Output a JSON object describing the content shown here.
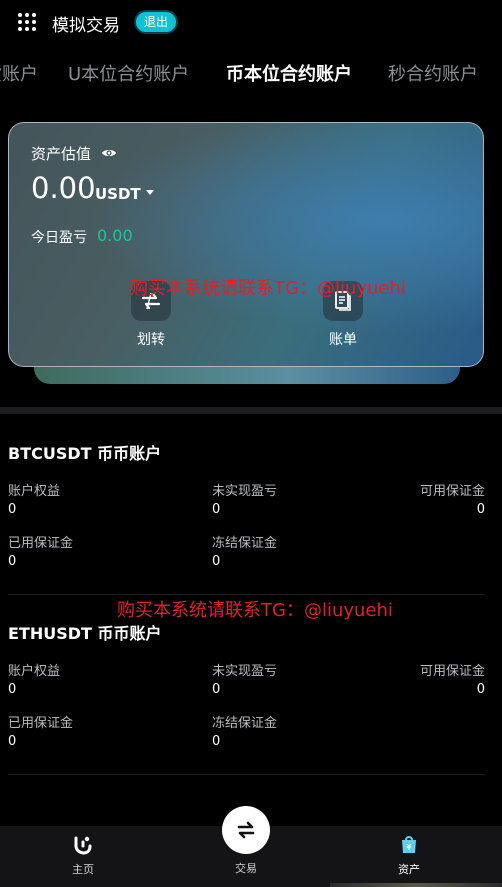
{
  "header": {
    "title": "模拟交易",
    "exit_label": "退出"
  },
  "tabs": [
    {
      "label": "现货账户"
    },
    {
      "label": "U本位合约账户"
    },
    {
      "label": "币本位合约账户",
      "active": true
    },
    {
      "label": "秒合约账户"
    }
  ],
  "asset_card": {
    "label": "资产估值",
    "value": "0.00",
    "unit": "USDT",
    "pnl_label": "今日盈亏",
    "pnl_value": "0.00",
    "actions": [
      {
        "label": "划转",
        "icon": "transfer-icon"
      },
      {
        "label": "账单",
        "icon": "bill-icon"
      }
    ]
  },
  "watermark": "购买本系统请联系TG：@liuyuehi",
  "accounts": [
    {
      "title": "BTCUSDT 币币账户",
      "fields": [
        {
          "label": "账户权益",
          "value": "0"
        },
        {
          "label": "未实现盈亏",
          "value": "0"
        },
        {
          "label": "可用保证金",
          "value": "0"
        },
        {
          "label": "已用保证金",
          "value": "0"
        },
        {
          "label": "冻结保证金",
          "value": "0"
        }
      ]
    },
    {
      "title": "ETHUSDT 币币账户",
      "fields": [
        {
          "label": "账户权益",
          "value": "0"
        },
        {
          "label": "未实现盈亏",
          "value": "0"
        },
        {
          "label": "可用保证金",
          "value": "0"
        },
        {
          "label": "已用保证金",
          "value": "0"
        },
        {
          "label": "冻结保证金",
          "value": "0"
        }
      ]
    }
  ],
  "bottom_nav": [
    {
      "label": "主页",
      "icon": "home-icon"
    },
    {
      "label": "交易",
      "icon": "trade-icon"
    },
    {
      "label": "资产",
      "icon": "assets-icon",
      "active": true
    }
  ],
  "colors": {
    "accent": "#10c2d8",
    "profit": "#19c79a",
    "watermark": "#e0202a"
  }
}
